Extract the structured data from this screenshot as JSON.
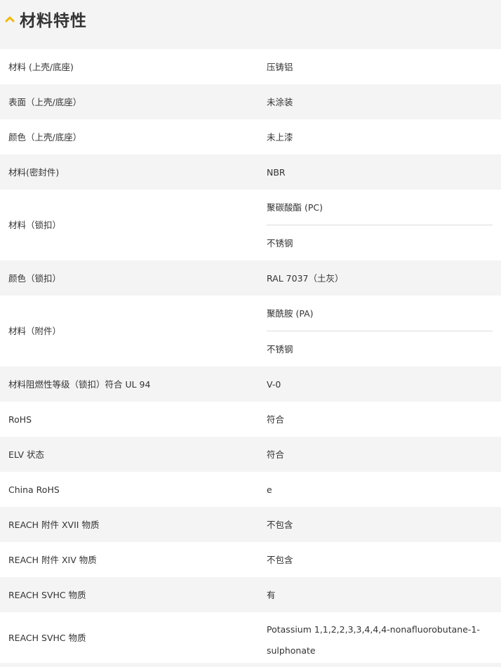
{
  "section": {
    "title": "材料特性",
    "accent_color": "#f3b800",
    "icon": "chevron-up-icon"
  },
  "rows": [
    {
      "label": "材料 (上壳/底座)",
      "values": [
        "压铸铝"
      ]
    },
    {
      "label": "表面（上壳/底座）",
      "values": [
        "未涂装"
      ]
    },
    {
      "label": "颜色（上壳/底座）",
      "values": [
        "未上漆"
      ]
    },
    {
      "label": "材料(密封件)",
      "values": [
        "NBR"
      ]
    },
    {
      "label": "材料（锁扣）",
      "values": [
        "聚碳酸酯 (PC)",
        "不锈钢"
      ]
    },
    {
      "label": "颜色（锁扣）",
      "values": [
        "RAL 7037（土灰）"
      ]
    },
    {
      "label": "材料（附件）",
      "values": [
        "聚酰胺 (PA)",
        "不锈钢"
      ]
    },
    {
      "label": "材料阻燃性等级（锁扣）符合 UL 94",
      "values": [
        "V-0"
      ]
    },
    {
      "label": "RoHS",
      "values": [
        "符合"
      ]
    },
    {
      "label": "ELV 状态",
      "values": [
        "符合"
      ]
    },
    {
      "label": "China RoHS",
      "values": [
        "e"
      ]
    },
    {
      "label": "REACH 附件 XVII 物质",
      "values": [
        "不包含"
      ]
    },
    {
      "label": "REACH 附件 XIV 物质",
      "values": [
        "不包含"
      ]
    },
    {
      "label": "REACH SVHC 物质",
      "values": [
        "有"
      ]
    },
    {
      "label": "REACH SVHC 物质",
      "values": [
        "Potassium 1,1,2,2,3,3,4,4,4-nonafluorobutane-1-sulphonate"
      ]
    }
  ]
}
